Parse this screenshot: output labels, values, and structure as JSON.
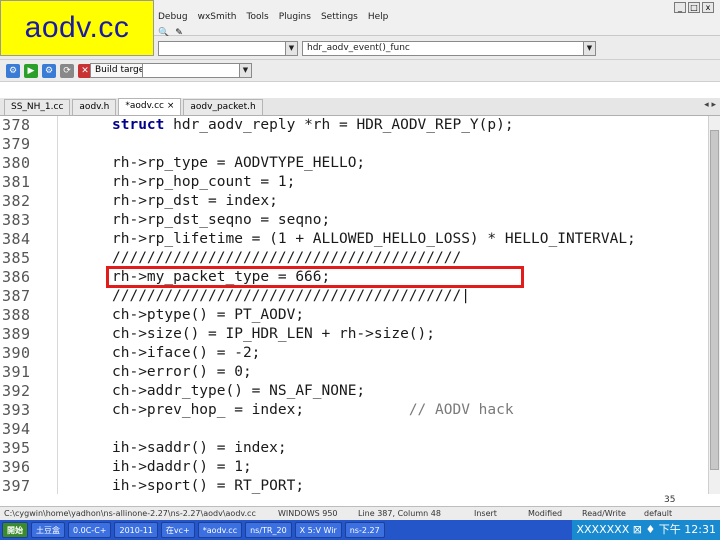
{
  "logo": "aodv.cc",
  "menu": [
    "Debug",
    "wxSmith",
    "Tools",
    "Plugins",
    "Settings",
    "Help"
  ],
  "window_controls": [
    "_",
    "□",
    "x"
  ],
  "toolbar1": {
    "function_combo": "hdr_aodv_event()_func"
  },
  "toolbar2": {
    "build_target_label": "Build target:"
  },
  "tabs": [
    "SS_NH_1.cc",
    "aodv.h",
    "*aodv.cc",
    "aodv_packet.h"
  ],
  "tab_nav": "◂ ▸",
  "editor": {
    "lines": [
      {
        "n": "378",
        "text": "struct hdr_aodv_reply *rh = HDR_AODV_REP_Y(p);",
        "kw": "struct"
      },
      {
        "n": "379",
        "text": ""
      },
      {
        "n": "380",
        "text": "rh->rp_type = AODVTYPE_HELLO;"
      },
      {
        "n": "381",
        "text": "rh->rp_hop_count = 1;"
      },
      {
        "n": "382",
        "text": "rh->rp_dst = index;"
      },
      {
        "n": "383",
        "text": "rh->rp_dst_seqno = seqno;"
      },
      {
        "n": "384",
        "text": "rh->rp_lifetime = (1 + ALLOWED_HELLO_LOSS) * HELLO_INTERVAL;"
      },
      {
        "n": "385",
        "text": "////////////////////////////////////////"
      },
      {
        "n": "386",
        "text": "rh->my_packet_type = 666;"
      },
      {
        "n": "387",
        "text": "////////////////////////////////////////|"
      },
      {
        "n": "388",
        "text": "ch->ptype() = PT_AODV;"
      },
      {
        "n": "389",
        "text": "ch->size() = IP_HDR_LEN + rh->size();"
      },
      {
        "n": "390",
        "text": "ch->iface() = -2;"
      },
      {
        "n": "391",
        "text": "ch->error() = 0;"
      },
      {
        "n": "392",
        "text": "ch->addr_type() = NS_AF_NONE;"
      },
      {
        "n": "393",
        "text": "ch->prev_hop_ = index;",
        "comment": "// AODV hack"
      },
      {
        "n": "394",
        "text": ""
      },
      {
        "n": "395",
        "text": "ih->saddr() = index;"
      },
      {
        "n": "396",
        "text": "ih->daddr() = 1;"
      },
      {
        "n": "397",
        "text": "ih->sport() = RT_PORT;"
      }
    ]
  },
  "page_number": "35",
  "status": [
    "C:\\cygwin\\home\\yadhon\\ns-allinone-2.27\\ns-2.27\\aodv\\aodv.cc",
    "WINDOWS 950",
    "Line 387, Column 48",
    "Insert",
    "Modified",
    "Read/Write",
    "default"
  ],
  "taskbar": [
    "開始",
    "土豆盒",
    "0.0C-C+",
    "2010-11",
    "在vc+",
    "*aodv.cc",
    "ns/TR_20",
    "X 5:V Wir",
    "ns-2.27"
  ],
  "tray": "XXXXXXX ⊠ ♦  下午 12:31",
  "colors": {
    "highlight": "#e21b1b",
    "logo_bg": "#ffff00",
    "logo_text": "#1a1aa8"
  }
}
